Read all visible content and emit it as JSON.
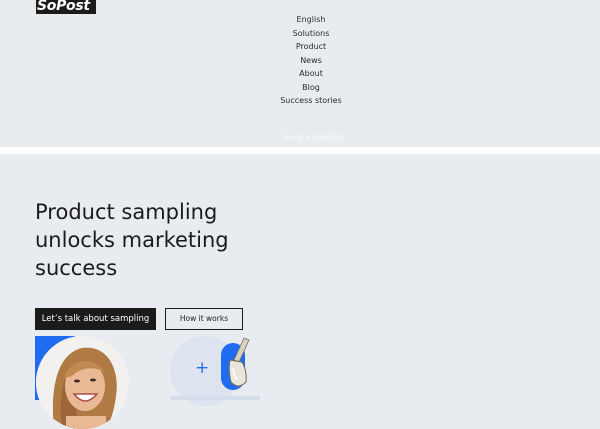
{
  "brand": {
    "logo_text": "SoPost"
  },
  "nav": {
    "items": [
      "English",
      "Solutions",
      "Product",
      "News",
      "About",
      "Blog",
      "Success stories"
    ],
    "cta": "Book a meeting"
  },
  "hero": {
    "title": "Product sampling unlocks marketing success",
    "primary_button": "Let’s talk about sampling",
    "secondary_button": "How it works"
  },
  "icons": {
    "plus": "+"
  },
  "colors": {
    "accent": "#1f6cf0",
    "dark": "#1b1b1b",
    "background": "#e8ecf0"
  }
}
